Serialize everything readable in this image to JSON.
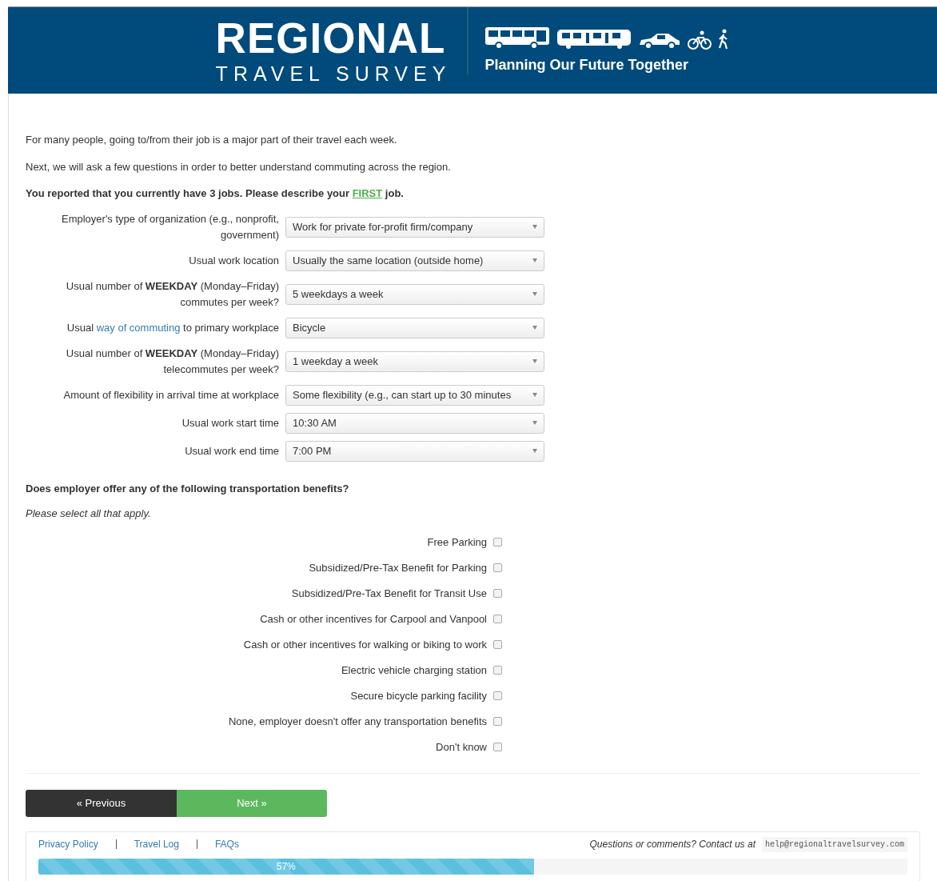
{
  "header": {
    "title": "REGIONAL",
    "subtitle": "TRAVEL SURVEY",
    "tagline": "Planning Our Future Together"
  },
  "intro": [
    "For many people, going to/from their job is a major part of their travel each week.",
    "Next, we will ask a few questions in order to better understand commuting across the region."
  ],
  "question": {
    "before": "You reported that you currently have 3 jobs. Please describe your ",
    "highlight": "FIRST",
    "after": " job."
  },
  "fields": [
    {
      "label": "Employer's type of organization (e.g., nonprofit, government)",
      "value": "Work for private for-profit firm/company"
    },
    {
      "label": "Usual work location",
      "value": "Usually the same location (outside home)"
    },
    {
      "label": "Usual number of **WEEKDAY** (Monday–Friday) commutes per week?",
      "value": "5 weekdays a week"
    },
    {
      "label": "Usual ",
      "link": "way of commuting",
      "label_after": " to primary workplace",
      "value": "Bicycle"
    },
    {
      "label": "Usual number of **WEEKDAY** (Monday–Friday) telecommutes per week?",
      "value": "1 weekday a week"
    },
    {
      "label": "Amount of flexibility in arrival time at workplace",
      "value": "Some flexibility (e.g., can start up to 30 minutes"
    },
    {
      "label": "Usual work start time",
      "value": "10:30 AM"
    },
    {
      "label": "Usual work end time",
      "value": "7:00 PM"
    }
  ],
  "benefits": {
    "title": "Does employer offer any of the following transportation benefits?",
    "hint": "Please select all that apply.",
    "items": [
      {
        "label": "Free Parking",
        "checked": false
      },
      {
        "label": "Subsidized/Pre-Tax Benefit for Parking",
        "checked": false
      },
      {
        "label": "Subsidized/Pre-Tax Benefit for Transit Use",
        "checked": false
      },
      {
        "label": "Cash or other incentives for Carpool and Vanpool",
        "checked": false
      },
      {
        "label": "Cash or other incentives for walking or biking to work",
        "checked": false
      },
      {
        "label": "Electric vehicle charging station",
        "checked": false
      },
      {
        "label": "Secure bicycle parking facility",
        "checked": false
      },
      {
        "label": "None, employer doesn't offer any transportation benefits",
        "checked": false
      },
      {
        "label": "Don't know",
        "checked": false
      }
    ]
  },
  "buttons": {
    "previous": "« Previous",
    "next": "Next »"
  },
  "footer": {
    "links": [
      "Privacy Policy",
      "Travel Log",
      "FAQs"
    ],
    "contact": "Questions or comments? Contact us at",
    "email": "help@regionaltravelsurvey.com",
    "progress": {
      "level": 0.57,
      "label": "57%"
    }
  }
}
